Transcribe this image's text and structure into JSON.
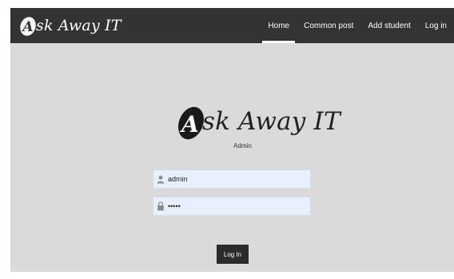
{
  "brand": {
    "logo_letter": "A",
    "name": "sk Away IT"
  },
  "nav": {
    "items": [
      {
        "label": "Home",
        "active": true
      },
      {
        "label": "Common post",
        "active": false
      },
      {
        "label": "Add student",
        "active": false
      },
      {
        "label": "Log in",
        "active": false
      }
    ]
  },
  "login": {
    "logo_letter": "A",
    "logo_name": "sk Away IT",
    "subtitle": "Admin",
    "username_value": "admin",
    "password_value": "•••••",
    "username_icon": "user-icon",
    "password_icon": "lock-icon",
    "submit_label": "Log In"
  },
  "colors": {
    "navbar": "#333333",
    "page_background": "#dadada",
    "input_background": "#e8f0fe",
    "button": "#2b2b2b"
  }
}
